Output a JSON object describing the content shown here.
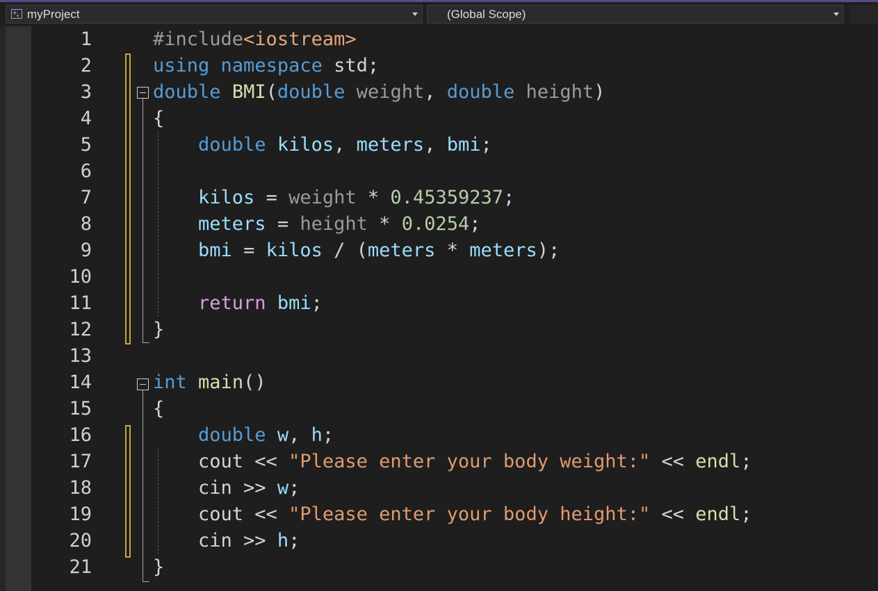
{
  "navbar": {
    "project": "myProject",
    "scope": "(Global Scope)",
    "project_icon": "cpp-project-icon",
    "caret_icon": "chevron-down-icon"
  },
  "colors": {
    "keyword": "#569cd6",
    "control": "#d8a0df",
    "function": "#dcdcaa",
    "variable": "#9cdcfe",
    "parameter": "#9a9a9a",
    "number": "#b5cea8",
    "string": "#e09a6f",
    "include_path": "#e6a678",
    "change_bar": "#c8a640"
  },
  "line_numbers": [
    "1",
    "2",
    "3",
    "4",
    "5",
    "6",
    "7",
    "8",
    "9",
    "10",
    "11",
    "12",
    "13",
    "14",
    "15",
    "16",
    "17",
    "18",
    "19",
    "20",
    "21"
  ],
  "code": {
    "l1": [
      "#include",
      "<iostream>"
    ],
    "l2": [
      "using",
      " ",
      "namespace",
      " std;"
    ],
    "l3": [
      "double",
      " ",
      "BMI",
      "(",
      "double",
      " ",
      "weight",
      ", ",
      "double",
      " ",
      "height",
      ")"
    ],
    "l4": [
      "{"
    ],
    "l5": [
      "    ",
      "double",
      " ",
      "kilos",
      ", ",
      "meters",
      ", ",
      "bmi",
      ";"
    ],
    "l6": [
      ""
    ],
    "l7": [
      "    ",
      "kilos",
      " = ",
      "weight",
      " * ",
      "0.45359237",
      ";"
    ],
    "l8": [
      "    ",
      "meters",
      " = ",
      "height",
      " * ",
      "0.0254",
      ";"
    ],
    "l9": [
      "    ",
      "bmi",
      " = ",
      "kilos",
      " / (",
      "meters",
      " * ",
      "meters",
      ");"
    ],
    "l10": [
      ""
    ],
    "l11": [
      "    ",
      "return",
      " ",
      "bmi",
      ";"
    ],
    "l12": [
      "}"
    ],
    "l13": [
      ""
    ],
    "l14": [
      "int",
      " ",
      "main",
      "()"
    ],
    "l15": [
      "{"
    ],
    "l16": [
      "    ",
      "double",
      " ",
      "w",
      ", ",
      "h",
      ";"
    ],
    "l17": [
      "    cout << ",
      "\"Please enter your body weight:\"",
      " << ",
      "endl",
      ";"
    ],
    "l18": [
      "    cin >> ",
      "w",
      ";"
    ],
    "l19": [
      "    cout << ",
      "\"Please enter your body height:\"",
      " << ",
      "endl",
      ";"
    ],
    "l20": [
      "    cin >> ",
      "h",
      ";"
    ],
    "l21": [
      "}"
    ]
  }
}
